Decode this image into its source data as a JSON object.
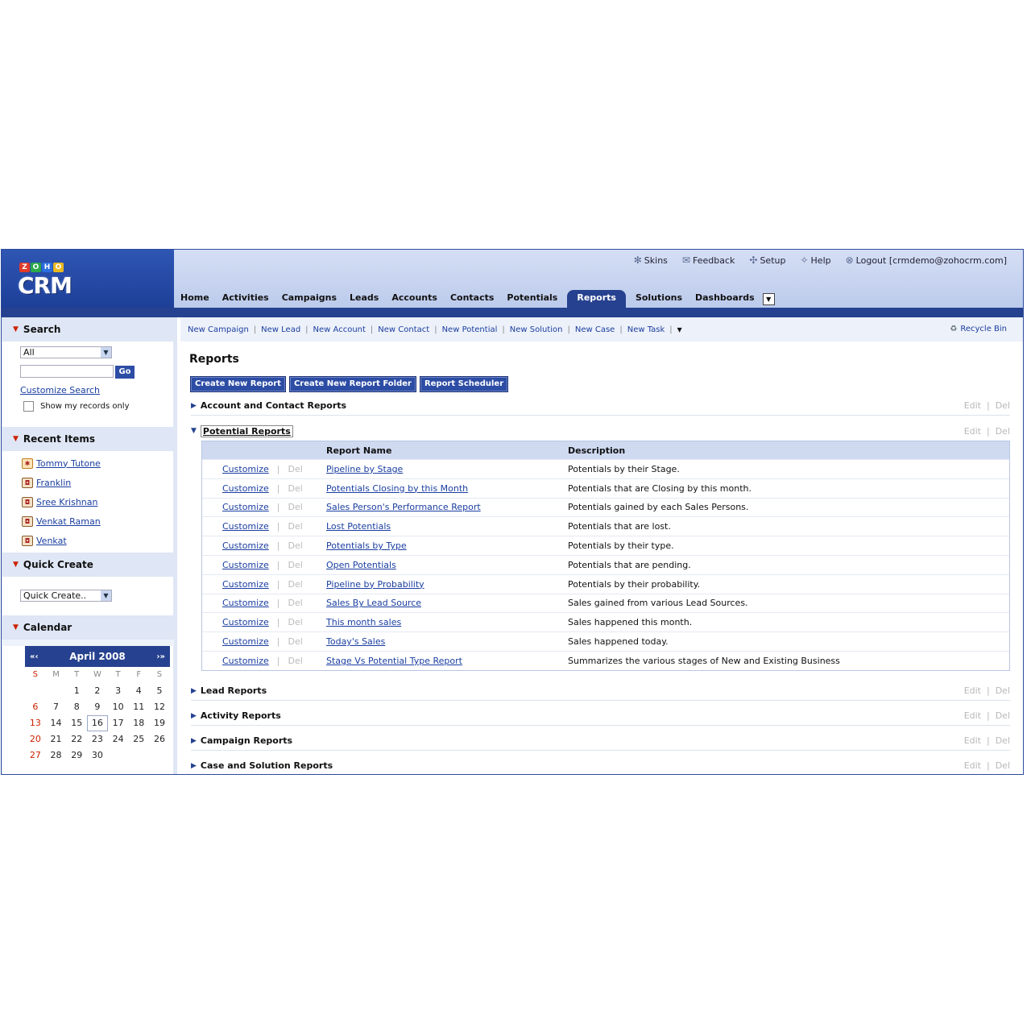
{
  "header": {
    "logo": {
      "zoho": [
        "Z",
        "O",
        "H",
        "O"
      ],
      "crm": "CRM"
    },
    "toplinks": [
      {
        "icon": "skins-icon",
        "glyph": "✻",
        "label": "Skins"
      },
      {
        "icon": "feedback-icon",
        "glyph": "✉",
        "label": "Feedback"
      },
      {
        "icon": "setup-icon",
        "glyph": "✣",
        "label": "Setup"
      },
      {
        "icon": "help-icon",
        "glyph": "✧",
        "label": "Help"
      },
      {
        "icon": "logout-icon",
        "glyph": "⊗",
        "label": "Logout [crmdemo@zohocrm.com]"
      }
    ],
    "tabs": [
      "Home",
      "Activities",
      "Campaigns",
      "Leads",
      "Accounts",
      "Contacts",
      "Potentials",
      "Reports",
      "Solutions",
      "Dashboards"
    ],
    "active_tab": "Reports"
  },
  "sidebar": {
    "search": {
      "title": "Search",
      "module_value": "All",
      "input_value": "",
      "go_label": "Go",
      "customize_link": "Customize Search",
      "my_records_label": "Show my records only"
    },
    "recent": {
      "title": "Recent Items",
      "items": [
        "Tommy Tutone",
        "Franklin",
        "Sree Krishnan",
        "Venkat Raman",
        "Venkat"
      ]
    },
    "quick_create": {
      "title": "Quick Create",
      "value": "Quick Create.."
    },
    "calendar": {
      "title": "Calendar",
      "month_label": "April 2008",
      "prev": "«‹",
      "next": "›»",
      "dow": [
        "S",
        "M",
        "T",
        "W",
        "T",
        "F",
        "S"
      ],
      "weeks": [
        [
          "",
          "",
          "1",
          "2",
          "3",
          "4",
          "5"
        ],
        [
          "6",
          "7",
          "8",
          "9",
          "10",
          "11",
          "12"
        ],
        [
          "13",
          "14",
          "15",
          "16",
          "17",
          "18",
          "19"
        ],
        [
          "20",
          "21",
          "22",
          "23",
          "24",
          "25",
          "26"
        ],
        [
          "27",
          "28",
          "29",
          "30",
          "",
          "",
          ""
        ]
      ],
      "today": "16"
    }
  },
  "main": {
    "quicklinks": [
      "New Campaign",
      "New Lead",
      "New Account",
      "New Contact",
      "New Potential",
      "New Solution",
      "New Case",
      "New Task"
    ],
    "quicklinks_more": "▾",
    "recycle_bin": "Recycle Bin",
    "title": "Reports",
    "actions": [
      "Create New Report",
      "Create New Report Folder",
      "Report Scheduler"
    ],
    "edit_label": "Edit",
    "del_label": "Del",
    "categories": {
      "account_contact": "Account and Contact Reports",
      "potential": "Potential Reports",
      "lead": "Lead Reports",
      "activity": "Activity Reports",
      "campaign": "Campaign Reports",
      "case_solution": "Case and Solution Reports"
    },
    "table": {
      "col_name": "Report Name",
      "col_desc": "Description",
      "customize_label": "Customize",
      "del_label": "Del",
      "rows": [
        {
          "name": "Pipeline by Stage",
          "desc": "Potentials by their Stage."
        },
        {
          "name": "Potentials Closing by this Month",
          "desc": "Potentials that are Closing by this month."
        },
        {
          "name": "Sales Person's Performance Report",
          "desc": "Potentials gained by each Sales Persons."
        },
        {
          "name": "Lost Potentials",
          "desc": "Potentials that are lost."
        },
        {
          "name": "Potentials by Type",
          "desc": "Potentials by their type."
        },
        {
          "name": "Open Potentials",
          "desc": "Potentials that are pending."
        },
        {
          "name": "Pipeline by Probability",
          "desc": "Potentials by their probability."
        },
        {
          "name": "Sales By Lead Source",
          "desc": "Sales gained from various Lead Sources."
        },
        {
          "name": "This month sales",
          "desc": "Sales happened this month."
        },
        {
          "name": "Today's Sales",
          "desc": "Sales happened today."
        },
        {
          "name": "Stage Vs Potential Type Report",
          "desc": "Summarizes the various stages of New and Existing Business"
        }
      ]
    }
  }
}
